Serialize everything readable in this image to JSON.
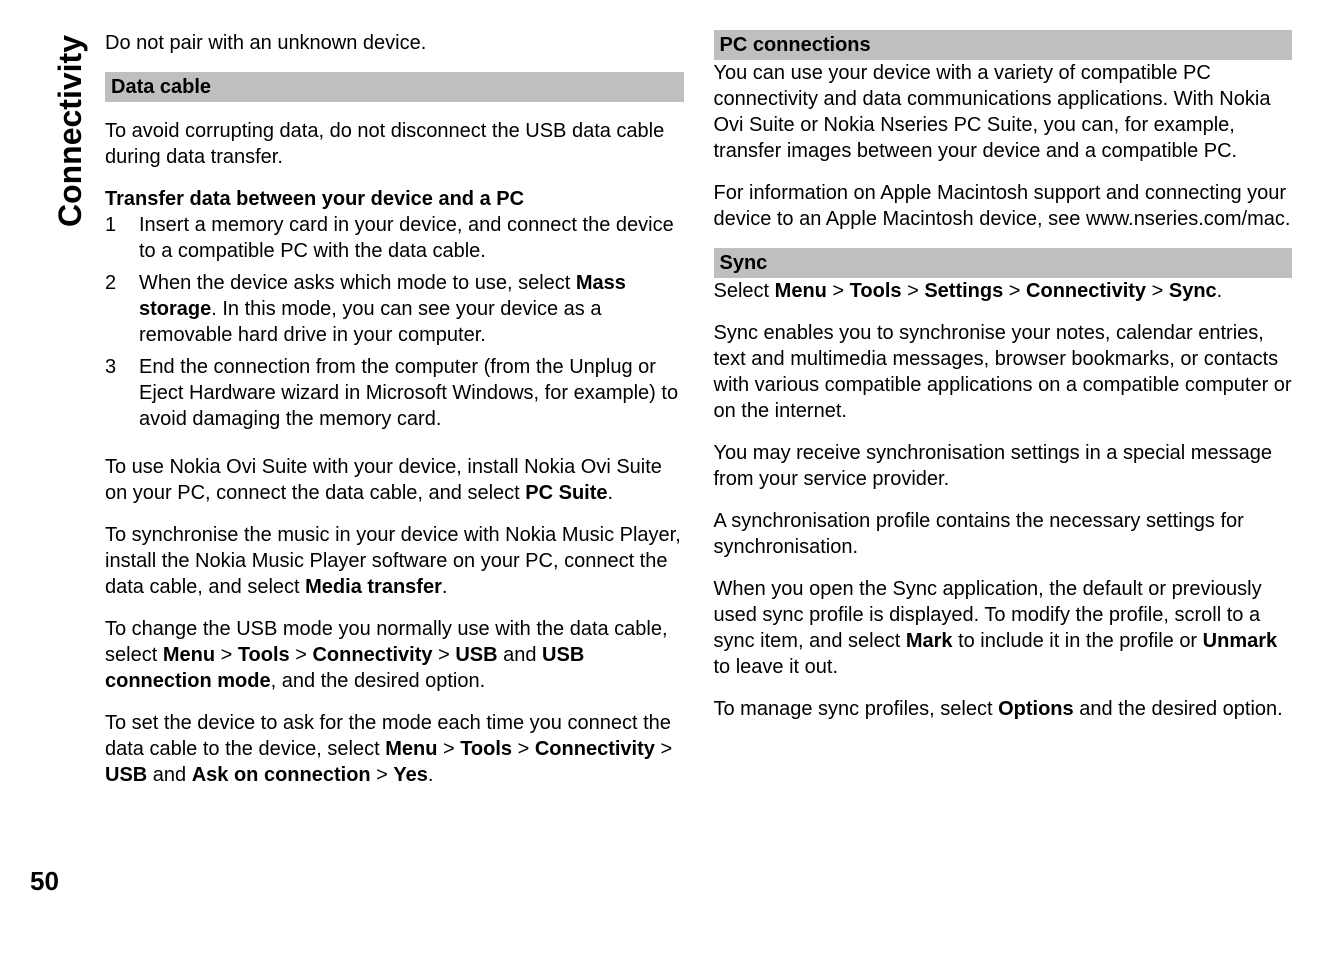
{
  "sideLabel": "Connectivity",
  "pageNumber": "50",
  "left": {
    "intro": "Do not pair with an unknown device.",
    "dataCable": {
      "heading": "Data cable",
      "p1": "To avoid corrupting data, do not disconnect the USB data cable during data transfer.",
      "sub": "Transfer data between your device and a PC",
      "step1num": "1",
      "step1": "Insert a memory card in your device, and connect the device to a compatible PC with the data cable.",
      "step2num": "2",
      "step2a": "When the device asks which mode to use, select ",
      "step2b": "Mass storage",
      "step2c": ". In this mode, you can see your device as a removable hard drive in your computer.",
      "step3num": "3",
      "step3": "End the connection from the computer (from the Unplug or Eject Hardware wizard in Microsoft Windows, for example) to avoid damaging the memory card.",
      "p2a": "To use Nokia Ovi Suite with your device, install Nokia Ovi Suite on your PC, connect the data cable, and select ",
      "p2b": "PC Suite",
      "p2c": ".",
      "p3a": "To synchronise the music in your device with Nokia Music Player, install the Nokia Music Player software on your PC, connect the data cable, and select ",
      "p3b": "Media transfer",
      "p3c": ".",
      "p4a": "To change the USB mode you normally use with the data cable, select ",
      "p4b": "Menu",
      "p4c": " > ",
      "p4d": "Tools",
      "p4e": " > ",
      "p4f": "Connectivity",
      "p4g": " > ",
      "p4h": "USB",
      "p4i": " and ",
      "p4j": "USB connection mode",
      "p4k": ", and the desired option.",
      "p5a": "To set the device to ask for the mode each time you connect the data cable to the device, select ",
      "p5b": "Menu",
      "p5c": " > ",
      "p5d": "Tools",
      "p5e": " > ",
      "p5f": "Connectivity",
      "p5g": " > ",
      "p5h": "USB",
      "p5i": " and ",
      "p5j": "Ask on connection",
      "p5k": " > ",
      "p5l": "Yes",
      "p5m": "."
    }
  },
  "right": {
    "pcConn": {
      "heading": "PC connections",
      "p1": "You can use your device with a variety of compatible PC connectivity and data communications applications. With Nokia Ovi Suite or Nokia Nseries PC Suite, you can, for example, transfer images between your device and a compatible PC.",
      "p2": "For information on Apple Macintosh support and connecting your device to an Apple Macintosh device, see www.nseries.com/mac."
    },
    "sync": {
      "heading": "Sync",
      "p1a": "Select ",
      "p1b": "Menu",
      "p1c": " > ",
      "p1d": "Tools",
      "p1e": " > ",
      "p1f": "Settings",
      "p1g": " > ",
      "p1h": "Connectivity",
      "p1i": " > ",
      "p1j": "Sync",
      "p1k": ".",
      "p2": "Sync enables you to synchronise your notes, calendar entries, text and multimedia messages, browser bookmarks, or contacts with various compatible applications on a compatible computer or on the internet.",
      "p3": "You may receive synchronisation settings in a special message from your service provider.",
      "p4": "A synchronisation profile contains the necessary settings for synchronisation.",
      "p5a": "When you open the Sync application, the default or previously used sync profile is displayed. To modify the profile, scroll to a sync item, and select ",
      "p5b": "Mark",
      "p5c": " to include it in the profile or ",
      "p5d": "Unmark",
      "p5e": " to leave it out.",
      "p6a": "To manage sync profiles, select ",
      "p6b": "Options",
      "p6c": " and the desired option."
    }
  }
}
